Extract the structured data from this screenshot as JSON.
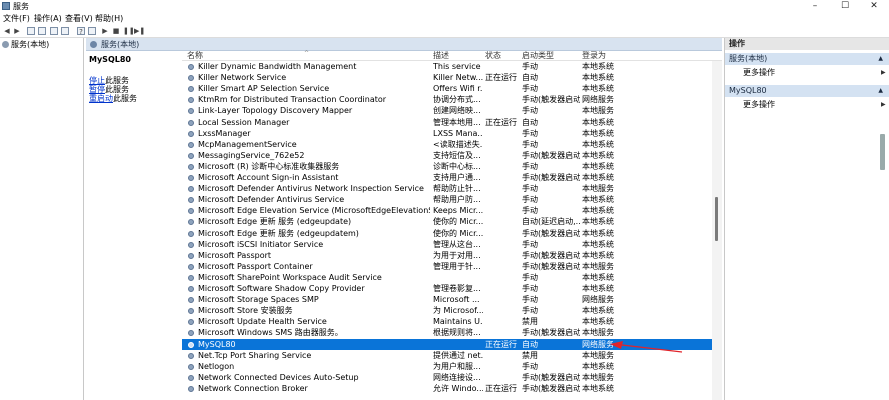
{
  "window": {
    "title": "服务",
    "minimize": "–",
    "maximize": "☐",
    "close": "✕"
  },
  "menu": [
    "文件(F)",
    "操作(A)",
    "查看(V)",
    "帮助(H)"
  ],
  "tree": {
    "root": "服务(本地)"
  },
  "main": {
    "header": "服务(本地)",
    "selected_service": "MySQL80",
    "links": [
      {
        "link": "停止",
        "rest": "此服务"
      },
      {
        "link": "暂停",
        "rest": "此服务"
      },
      {
        "link": "重启动",
        "rest": "此服务"
      }
    ],
    "columns": {
      "name": "名称",
      "desc": "描述",
      "status": "状态",
      "startup": "启动类型",
      "logon": "登录为"
    }
  },
  "rows": [
    {
      "name": "Killer Dynamic Bandwidth Management",
      "desc": "This service ...",
      "status": "",
      "startup": "手动",
      "logon": "本地系统"
    },
    {
      "name": "Killer Network Service",
      "desc": "Killer Netw...",
      "status": "正在运行",
      "startup": "自动",
      "logon": "本地系统"
    },
    {
      "name": "Killer Smart AP Selection Service",
      "desc": "Offers Wifi r...",
      "status": "",
      "startup": "手动",
      "logon": "本地系统"
    },
    {
      "name": "KtmRm for Distributed Transaction Coordinator",
      "desc": "协调分布式...",
      "status": "",
      "startup": "手动(触发器启动)",
      "logon": "网络服务"
    },
    {
      "name": "Link-Layer Topology Discovery Mapper",
      "desc": "创建网络映...",
      "status": "",
      "startup": "手动",
      "logon": "本地服务"
    },
    {
      "name": "Local Session Manager",
      "desc": "管理本地用...",
      "status": "正在运行",
      "startup": "自动",
      "logon": "本地系统"
    },
    {
      "name": "LxssManager",
      "desc": "LXSS Mana...",
      "status": "",
      "startup": "手动",
      "logon": "本地系统"
    },
    {
      "name": "McpManagementService",
      "desc": "<读取描述失...",
      "status": "",
      "startup": "手动",
      "logon": "本地系统"
    },
    {
      "name": "MessagingService_762e52",
      "desc": "支持短信及...",
      "status": "",
      "startup": "手动(触发器启动)",
      "logon": "本地系统"
    },
    {
      "name": "Microsoft (R) 诊断中心标准收集器服务",
      "desc": "诊断中心标...",
      "status": "",
      "startup": "手动",
      "logon": "本地系统"
    },
    {
      "name": "Microsoft Account Sign-in Assistant",
      "desc": "支持用户通...",
      "status": "",
      "startup": "手动(触发器启动)",
      "logon": "本地系统"
    },
    {
      "name": "Microsoft Defender Antivirus Network Inspection Service",
      "desc": "帮助防止针...",
      "status": "",
      "startup": "手动",
      "logon": "本地服务"
    },
    {
      "name": "Microsoft Defender Antivirus Service",
      "desc": "帮助用户防...",
      "status": "",
      "startup": "手动",
      "logon": "本地系统"
    },
    {
      "name": "Microsoft Edge Elevation Service (MicrosoftEdgeElevationService)",
      "desc": "Keeps Micr...",
      "status": "",
      "startup": "手动",
      "logon": "本地系统"
    },
    {
      "name": "Microsoft Edge 更新 服务 (edgeupdate)",
      "desc": "使你的 Micr...",
      "status": "",
      "startup": "自动(延迟启动,...",
      "logon": "本地系统"
    },
    {
      "name": "Microsoft Edge 更新 服务 (edgeupdatem)",
      "desc": "使你的 Micr...",
      "status": "",
      "startup": "手动(触发器启动)",
      "logon": "本地系统"
    },
    {
      "name": "Microsoft iSCSI Initiator Service",
      "desc": "管理从这台...",
      "status": "",
      "startup": "手动",
      "logon": "本地系统"
    },
    {
      "name": "Microsoft Passport",
      "desc": "为用于对用...",
      "status": "",
      "startup": "手动(触发器启动)",
      "logon": "本地系统"
    },
    {
      "name": "Microsoft Passport Container",
      "desc": "管理用于针...",
      "status": "",
      "startup": "手动(触发器启动)",
      "logon": "本地服务"
    },
    {
      "name": "Microsoft SharePoint Workspace Audit Service",
      "desc": "",
      "status": "",
      "startup": "手动",
      "logon": "本地系统"
    },
    {
      "name": "Microsoft Software Shadow Copy Provider",
      "desc": "管理卷影复...",
      "status": "",
      "startup": "手动",
      "logon": "本地系统"
    },
    {
      "name": "Microsoft Storage Spaces SMP",
      "desc": "Microsoft ...",
      "status": "",
      "startup": "手动",
      "logon": "网络服务"
    },
    {
      "name": "Microsoft Store 安装服务",
      "desc": "为 Microsof...",
      "status": "",
      "startup": "手动",
      "logon": "本地系统"
    },
    {
      "name": "Microsoft Update Health Service",
      "desc": "Maintains U...",
      "status": "",
      "startup": "禁用",
      "logon": "本地系统"
    },
    {
      "name": "Microsoft Windows SMS 路由器服务。",
      "desc": "根据规则将...",
      "status": "",
      "startup": "手动(触发器启动)",
      "logon": "本地服务"
    },
    {
      "name": "MySQL80",
      "desc": "",
      "status": "正在运行",
      "startup": "自动",
      "logon": "网络服务",
      "selected": true
    },
    {
      "name": "Net.Tcp Port Sharing Service",
      "desc": "提供通过 net...",
      "status": "",
      "startup": "禁用",
      "logon": "本地服务"
    },
    {
      "name": "Netlogon",
      "desc": "为用户和服...",
      "status": "",
      "startup": "手动",
      "logon": "本地系统"
    },
    {
      "name": "Network Connected Devices Auto-Setup",
      "desc": "网络连接设...",
      "status": "",
      "startup": "手动(触发器启动)",
      "logon": "本地服务"
    },
    {
      "name": "Network Connection Broker",
      "desc": "允许 Windo...",
      "status": "正在运行",
      "startup": "手动(触发器启动)",
      "logon": "本地系统"
    }
  ],
  "actions": {
    "header": "操作",
    "sections": [
      {
        "title": "服务(本地)",
        "item": "更多操作"
      },
      {
        "title": "MySQL80",
        "item": "更多操作"
      }
    ]
  },
  "annotation_color": "#e0242b",
  "selection_color": "#0a74d8"
}
